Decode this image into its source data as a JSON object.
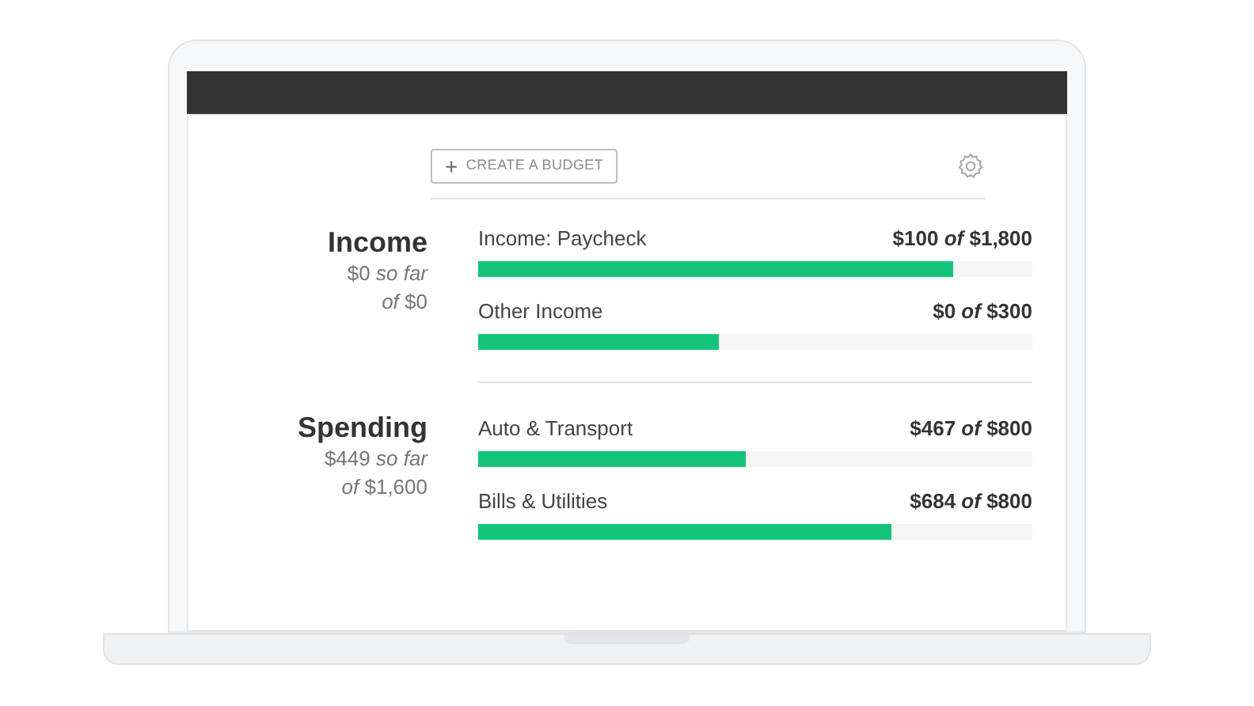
{
  "toolbar": {
    "create_button": "+ CREATE A BUDGET"
  },
  "sections": [
    {
      "title": "Income",
      "summary": [
        "$0 *so far*",
        "*of* $0"
      ],
      "rows": [
        {
          "label": "Income: Paycheck",
          "amount": "$100 *of* $1,800",
          "level": 0.857
        },
        {
          "label": "Other Income",
          "amount": "$0 *of* $300",
          "level": 0.434
        }
      ]
    },
    {
      "title": "Spending",
      "summary": [
        "$449 *so far*",
        "*of* $1,600"
      ],
      "rows": [
        {
          "label": "Auto & Transport",
          "amount": "$467 *of* $800",
          "level": 0.483
        },
        {
          "label": "Bills & Utilities",
          "amount": "$684 *of* $800",
          "level": 0.746
        }
      ]
    }
  ]
}
